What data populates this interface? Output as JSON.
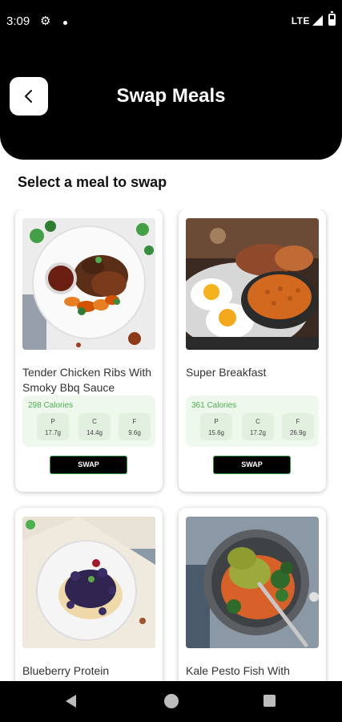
{
  "status_bar": {
    "time": "3:09",
    "network": "LTE",
    "icons": [
      "gear-icon",
      "notification-dot-icon",
      "signal-icon",
      "battery-icon"
    ]
  },
  "header": {
    "title": "Swap Meals",
    "back_icon": "chevron-left-icon"
  },
  "section_title": "Select a meal to swap",
  "colors": {
    "header_bg": "#000000",
    "accent_green": "#4caf50",
    "nutrition_bg": "#eef8ec",
    "swap_button_bg": "#000000"
  },
  "meals": [
    {
      "name": "Tender Chicken Ribs With Smoky Bbq Sauce",
      "calories": "298 Calories",
      "macros": [
        {
          "label": "P",
          "value": "17.7g"
        },
        {
          "label": "C",
          "value": "14.4g"
        },
        {
          "label": "F",
          "value": "9.6g"
        }
      ],
      "swap_label": "SWAP",
      "image": "chicken-ribs-photo"
    },
    {
      "name": "Super Breakfast",
      "calories": "361 Calories",
      "macros": [
        {
          "label": "P",
          "value": "15.6g"
        },
        {
          "label": "C",
          "value": "17.2g"
        },
        {
          "label": "F",
          "value": "26.9g"
        }
      ],
      "swap_label": "SWAP",
      "image": "breakfast-photo"
    },
    {
      "name": "Blueberry Protein",
      "image": "blueberry-pancakes-photo"
    },
    {
      "name": "Kale Pesto Fish With",
      "image": "pesto-fish-photo"
    }
  ],
  "nav_bar": {
    "icons": [
      "nav-back-icon",
      "nav-home-icon",
      "nav-recents-icon"
    ]
  }
}
